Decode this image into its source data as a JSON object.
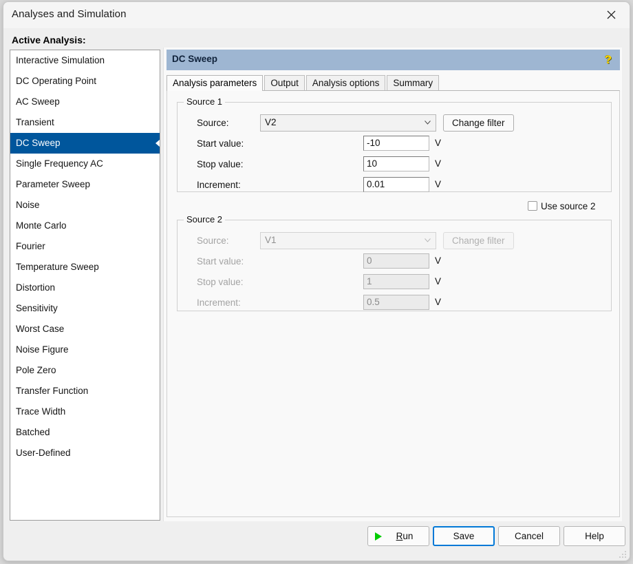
{
  "window": {
    "title": "Analyses and Simulation",
    "close_icon": "close-icon"
  },
  "sidebar": {
    "heading": "Active Analysis:",
    "selected": "DC Sweep",
    "items": [
      {
        "label": "Interactive Simulation"
      },
      {
        "label": "DC Operating Point"
      },
      {
        "label": "AC Sweep"
      },
      {
        "label": "Transient"
      },
      {
        "label": "DC Sweep"
      },
      {
        "label": "Single Frequency AC"
      },
      {
        "label": "Parameter Sweep"
      },
      {
        "label": "Noise"
      },
      {
        "label": "Monte Carlo"
      },
      {
        "label": "Fourier"
      },
      {
        "label": "Temperature Sweep"
      },
      {
        "label": "Distortion"
      },
      {
        "label": "Sensitivity"
      },
      {
        "label": "Worst Case"
      },
      {
        "label": "Noise Figure"
      },
      {
        "label": "Pole Zero"
      },
      {
        "label": "Transfer Function"
      },
      {
        "label": "Trace Width"
      },
      {
        "label": "Batched"
      },
      {
        "label": "User-Defined"
      }
    ]
  },
  "panel": {
    "header_title": "DC Sweep",
    "help_icon": "question-mark-icon",
    "header_color": "#9eb6d2",
    "tabs": [
      {
        "label": "Analysis parameters",
        "active": true
      },
      {
        "label": "Output",
        "active": false
      },
      {
        "label": "Analysis options",
        "active": false
      },
      {
        "label": "Summary",
        "active": false
      }
    ]
  },
  "source1": {
    "title": "Source 1",
    "source_label": "Source:",
    "source_value": "V2",
    "change_filter_label": "Change filter",
    "start_label": "Start value:",
    "start_value": "-10",
    "start_unit": "V",
    "stop_label": "Stop value:",
    "stop_value": "10",
    "stop_unit": "V",
    "increment_label": "Increment:",
    "increment_value": "0.01",
    "increment_unit": "V"
  },
  "use_source2": {
    "label": "Use source 2",
    "checked": false
  },
  "source2": {
    "title": "Source 2",
    "source_label": "Source:",
    "source_value": "V1",
    "change_filter_label": "Change filter",
    "start_label": "Start value:",
    "start_value": "0",
    "start_unit": "V",
    "stop_label": "Stop value:",
    "stop_value": "1",
    "stop_unit": "V",
    "increment_label": "Increment:",
    "increment_value": "0.5",
    "increment_unit": "V"
  },
  "footer": {
    "run_label_prefix": "R",
    "run_label_rest": "un",
    "run_icon": "play-triangle-icon",
    "run_icon_color": "#00cc00",
    "save_label": "Save",
    "cancel_label": "Cancel",
    "help_label": "Help",
    "focus_color": "#0078d7"
  }
}
